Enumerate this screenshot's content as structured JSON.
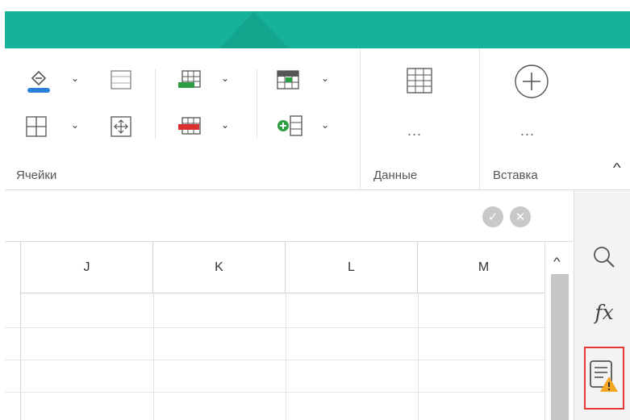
{
  "ribbon": {
    "groups": [
      {
        "label": "Ячейки"
      },
      {
        "label": "Данные",
        "more": "..."
      },
      {
        "label": "Вставка",
        "more": "..."
      }
    ],
    "caret": "⌄",
    "collapse": "^"
  },
  "formula_bar": {
    "confirm": "✓",
    "cancel": "✕"
  },
  "sheet": {
    "columns": [
      "J",
      "K",
      "L",
      "M"
    ],
    "scroll_up": "^"
  },
  "side_panel": {
    "items": [
      {
        "icon": "search-icon"
      },
      {
        "icon": "function-icon",
        "label": "fx"
      },
      {
        "icon": "notes-warning-icon",
        "highlighted": true
      }
    ]
  },
  "colors": {
    "accent": "#16b39a",
    "highlight": "#e53935",
    "warning": "#f5a623"
  }
}
